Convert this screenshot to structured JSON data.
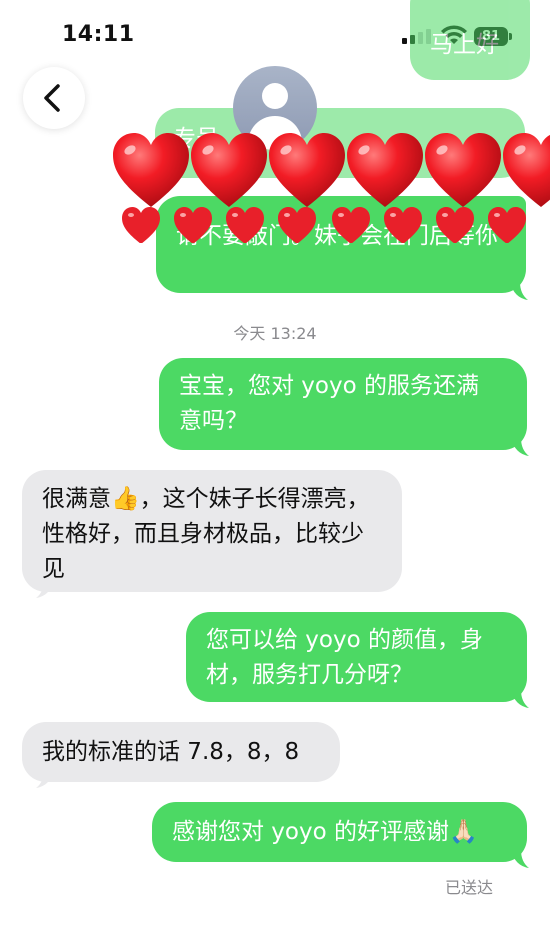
{
  "status_bar": {
    "time": "14:11",
    "battery": "81"
  },
  "header": {
    "avatar": "person-icon"
  },
  "messages": {
    "top_sent_partial": "马上好",
    "top_sent_faded": "专号",
    "sent_top_text": "请不要敲门。妹子会在门后等你",
    "timestamp": "今天 13:24",
    "m1": "宝宝，您对 yoyo 的服务还满意吗？",
    "m2": "很满意👍，这个妹子长得漂亮，性格好，而且身材极品，比较少见",
    "m3": "您可以给 yoyo 的颜值，身材，服务打几分呀？",
    "m4": "我的标准的话 7.8，8，8",
    "m5": "感谢您对 yoyo 的好评感谢🙏🏻",
    "delivered": "已送达"
  },
  "colors": {
    "sent_bubble": "#4cd964",
    "received_bubble": "#e9e9eb",
    "heart": "#e8202a"
  }
}
